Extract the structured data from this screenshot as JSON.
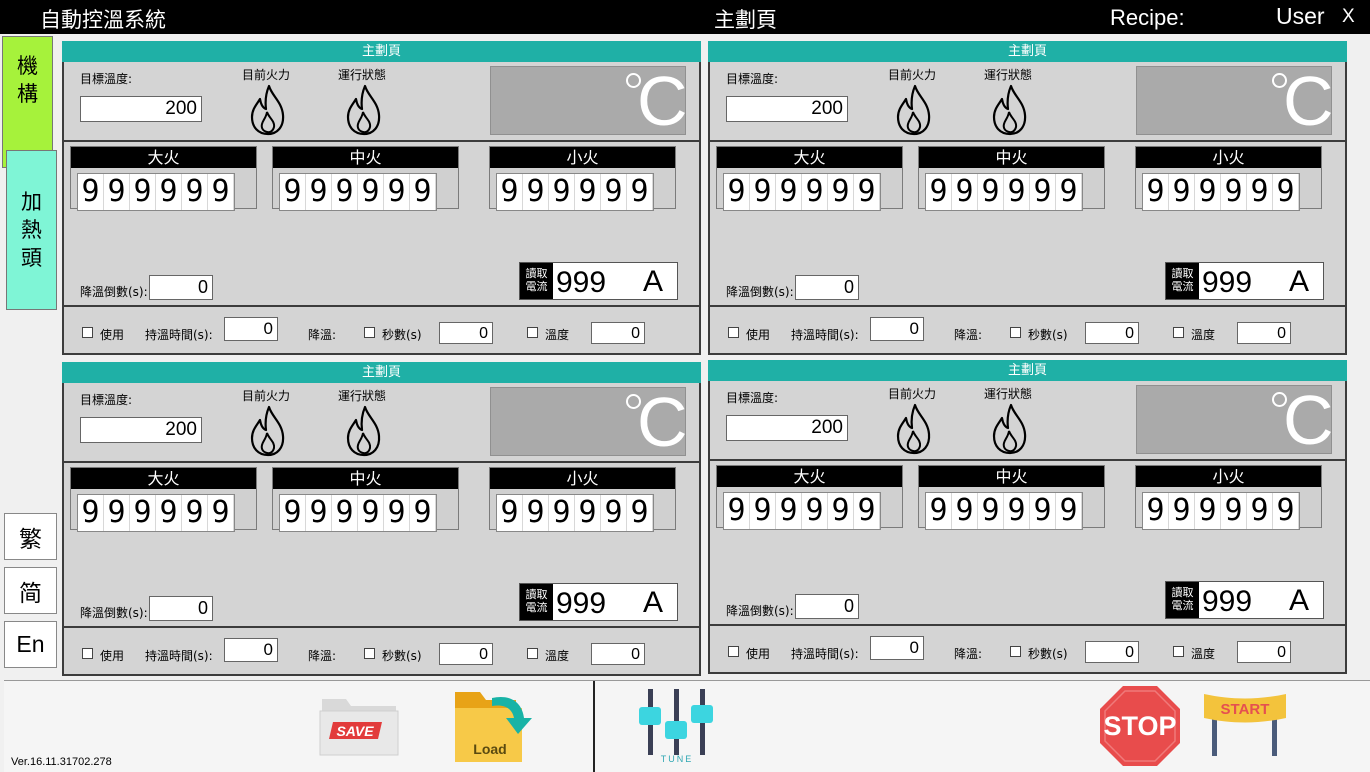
{
  "titlebar": {
    "app_name": "自動控溫系統",
    "page_title": "主劃頁",
    "recipe_label": "Recipe:",
    "user_label": "User",
    "close": "X"
  },
  "sidebar": {
    "mechanism": "機\n構",
    "heater": "加\n熱\n頭"
  },
  "languages": {
    "traditional": "繁",
    "simplified": "简",
    "english": "En"
  },
  "panels": [
    {
      "header": "主劃頁",
      "target_label": "目標溫度:",
      "target_value": "200",
      "fire_label": "目前火力",
      "status_label": "運行狀態",
      "big_label": "大火",
      "big_value": [
        "9",
        "9",
        "9",
        "9",
        "9",
        "9"
      ],
      "mid_label": "中火",
      "mid_value": [
        "9",
        "9",
        "9",
        "9",
        "9",
        "9"
      ],
      "small_label": "小火",
      "small_value": [
        "9",
        "9",
        "9",
        "9",
        "9",
        "9"
      ],
      "cooldown_label": "降溫倒數(s):",
      "cooldown_value": "0",
      "current_tag": "讀取\n電流",
      "current_value": "999",
      "current_unit": "A",
      "use_label": "使用",
      "hold_label": "持溫時間(s):",
      "hold_value": "0",
      "cool_label": "降溫:",
      "sec_label": "秒數(s)",
      "sec_value": "0",
      "temp_label": "溫度",
      "temp_value": "0"
    },
    {
      "header": "主劃頁",
      "target_label": "目標溫度:",
      "target_value": "200",
      "fire_label": "目前火力",
      "status_label": "運行狀態",
      "big_label": "大火",
      "big_value": [
        "9",
        "9",
        "9",
        "9",
        "9",
        "9"
      ],
      "mid_label": "中火",
      "mid_value": [
        "9",
        "9",
        "9",
        "9",
        "9",
        "9"
      ],
      "small_label": "小火",
      "small_value": [
        "9",
        "9",
        "9",
        "9",
        "9",
        "9"
      ],
      "cooldown_label": "降溫倒數(s):",
      "cooldown_value": "0",
      "current_tag": "讀取\n電流",
      "current_value": "999",
      "current_unit": "A",
      "use_label": "使用",
      "hold_label": "持溫時間(s):",
      "hold_value": "0",
      "cool_label": "降溫:",
      "sec_label": "秒數(s)",
      "sec_value": "0",
      "temp_label": "溫度",
      "temp_value": "0"
    },
    {
      "header": "主劃頁",
      "target_label": "目標溫度:",
      "target_value": "200",
      "fire_label": "目前火力",
      "status_label": "運行狀態",
      "big_label": "大火",
      "big_value": [
        "9",
        "9",
        "9",
        "9",
        "9",
        "9"
      ],
      "mid_label": "中火",
      "mid_value": [
        "9",
        "9",
        "9",
        "9",
        "9",
        "9"
      ],
      "small_label": "小火",
      "small_value": [
        "9",
        "9",
        "9",
        "9",
        "9",
        "9"
      ],
      "cooldown_label": "降溫倒數(s):",
      "cooldown_value": "0",
      "current_tag": "讀取\n電流",
      "current_value": "999",
      "current_unit": "A",
      "use_label": "使用",
      "hold_label": "持溫時間(s):",
      "hold_value": "0",
      "cool_label": "降溫:",
      "sec_label": "秒數(s)",
      "sec_value": "0",
      "temp_label": "溫度",
      "temp_value": "0"
    },
    {
      "header": "主劃頁",
      "target_label": "目標溫度:",
      "target_value": "200",
      "fire_label": "目前火力",
      "status_label": "運行狀態",
      "big_label": "大火",
      "big_value": [
        "9",
        "9",
        "9",
        "9",
        "9",
        "9"
      ],
      "mid_label": "中火",
      "mid_value": [
        "9",
        "9",
        "9",
        "9",
        "9",
        "9"
      ],
      "small_label": "小火",
      "small_value": [
        "9",
        "9",
        "9",
        "9",
        "9",
        "9"
      ],
      "cooldown_label": "降溫倒數(s):",
      "cooldown_value": "0",
      "current_tag": "讀取\n電流",
      "current_value": "999",
      "current_unit": "A",
      "use_label": "使用",
      "hold_label": "持溫時間(s):",
      "hold_value": "0",
      "cool_label": "降溫:",
      "sec_label": "秒數(s)",
      "sec_value": "0",
      "temp_label": "溫度",
      "temp_value": "0"
    }
  ],
  "temp_unit": "C",
  "toolbar": {
    "save_label": "SAVE",
    "load_label": "Load",
    "tune_label": "TUNE",
    "stop_label": "STOP",
    "start_label": "START"
  },
  "version": "Ver.16.11.31702.278",
  "colors": {
    "accent_teal": "#1fb0a6",
    "tab_green": "#a6f23b",
    "tab_mint": "#7ff5d6",
    "stop_red": "#e84c4c",
    "start_gold": "#f3c33c"
  }
}
